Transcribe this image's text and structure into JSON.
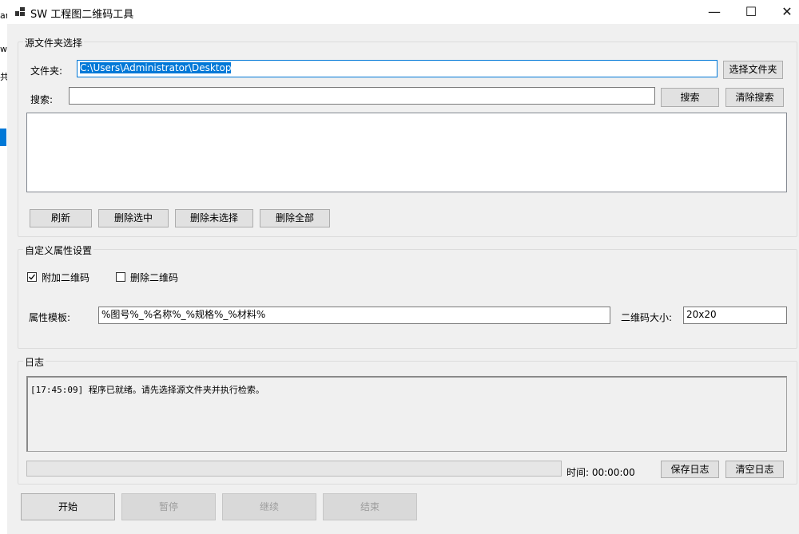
{
  "bg_window": {
    "fragments": [
      "ar",
      "w",
      "共"
    ]
  },
  "window": {
    "title": "SW 工程图二维码工具",
    "minimize": "—",
    "maximize": "☐",
    "close": "✕"
  },
  "source_group": {
    "legend": "源文件夹选择",
    "folder_label": "文件夹:",
    "folder_value": "C:\\Users\\Administrator\\Desktop",
    "choose_folder_btn": "选择文件夹",
    "search_label": "搜索:",
    "search_value": "",
    "search_btn": "搜索",
    "clear_search_btn": "清除搜索",
    "file_list": [],
    "refresh_btn": "刷新",
    "delete_selected_btn": "删除选中",
    "delete_unselected_btn": "删除未选择",
    "delete_all_btn": "删除全部"
  },
  "attr_group": {
    "legend": "自定义属性设置",
    "attach_qr": {
      "label": "附加二维码",
      "checked": true
    },
    "delete_qr": {
      "label": "删除二维码",
      "checked": false
    },
    "template_label": "属性模板:",
    "template_value": "%图号%_%名称%_%规格%_%材料%",
    "qr_size_label": "二维码大小:",
    "qr_size_value": "20x20"
  },
  "log_group": {
    "legend": "日志",
    "lines": [
      "[17:45:09] 程序已就绪。请先选择源文件夹并执行检索。"
    ],
    "progress": 0,
    "time_text": "时间: 00:00:00",
    "save_log_btn": "保存日志",
    "clear_log_btn": "清空日志"
  },
  "actions": {
    "start": "开始",
    "pause": "暂停",
    "resume": "继续",
    "end": "结束"
  }
}
